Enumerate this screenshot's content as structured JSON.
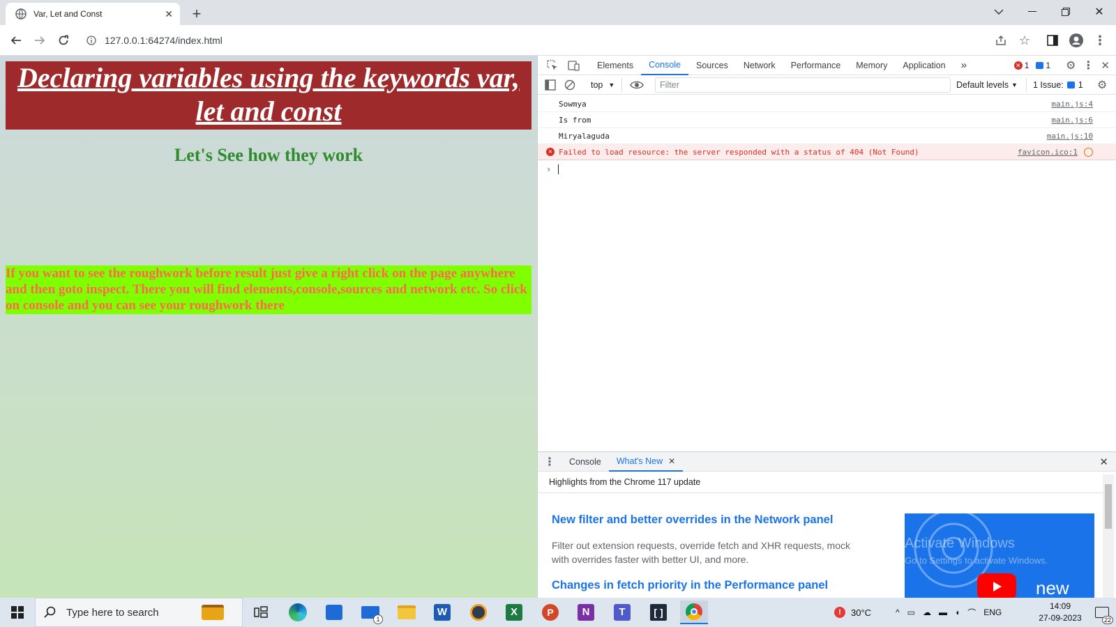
{
  "browser": {
    "tab_title": "Var, Let and Const",
    "url": "127.0.0.1:64274/index.html"
  },
  "page": {
    "heading": "Declaring variables using the keywords var, let and const",
    "subheading": "Let's See how they work",
    "note": "If you want to see the roughwork before result just give a right click on the page anywhere and then goto inspect. There you will find elements,console,sources and network etc. So click on console and you can see your roughwork there"
  },
  "devtools": {
    "tabs": [
      "Elements",
      "Console",
      "Sources",
      "Network",
      "Performance",
      "Memory",
      "Application"
    ],
    "active_tab": "Console",
    "error_count": "1",
    "message_count": "1",
    "context": "top",
    "filter_placeholder": "Filter",
    "levels": "Default levels",
    "issues_label": "1 Issue:",
    "issues_count": "1",
    "console": [
      {
        "text": "Sowmya",
        "source": "main.js:4",
        "type": "log"
      },
      {
        "text": "Is from",
        "source": "main.js:6",
        "type": "log"
      },
      {
        "text": "Miryalaguda",
        "source": "main.js:10",
        "type": "log"
      },
      {
        "text": "Failed to load resource: the server responded with a status of 404 (Not Found)",
        "source": "favicon.ico:1",
        "type": "error"
      }
    ],
    "drawer": {
      "tabs": [
        "Console",
        "What's New"
      ],
      "active_tab": "What's New",
      "highlights": "Highlights from the Chrome 117 update",
      "items": [
        {
          "title": "New filter and better overrides in the Network panel",
          "body": "Filter out extension requests, override fetch and XHR requests, mock with overrides faster with better UI, and more."
        },
        {
          "title": "Changes in fetch priority in the Performance panel",
          "body": ""
        }
      ],
      "video_label": "new",
      "watermark_line1": "Activate Windows",
      "watermark_line2": "Go to Settings to activate Windows."
    }
  },
  "taskbar": {
    "search_placeholder": "Type here to search",
    "weather": "30°C",
    "language": "ENG",
    "time": "14:09",
    "date": "27-09-2023",
    "notification_count": "22",
    "mail_badge": "1"
  },
  "colors": {
    "hero_bg": "#9e2a2b",
    "note_bg": "#7fff00",
    "note_text": "#ff6a4f",
    "subheading": "#2e8b2e",
    "accent": "#1a73e8",
    "error": "#d93025"
  }
}
